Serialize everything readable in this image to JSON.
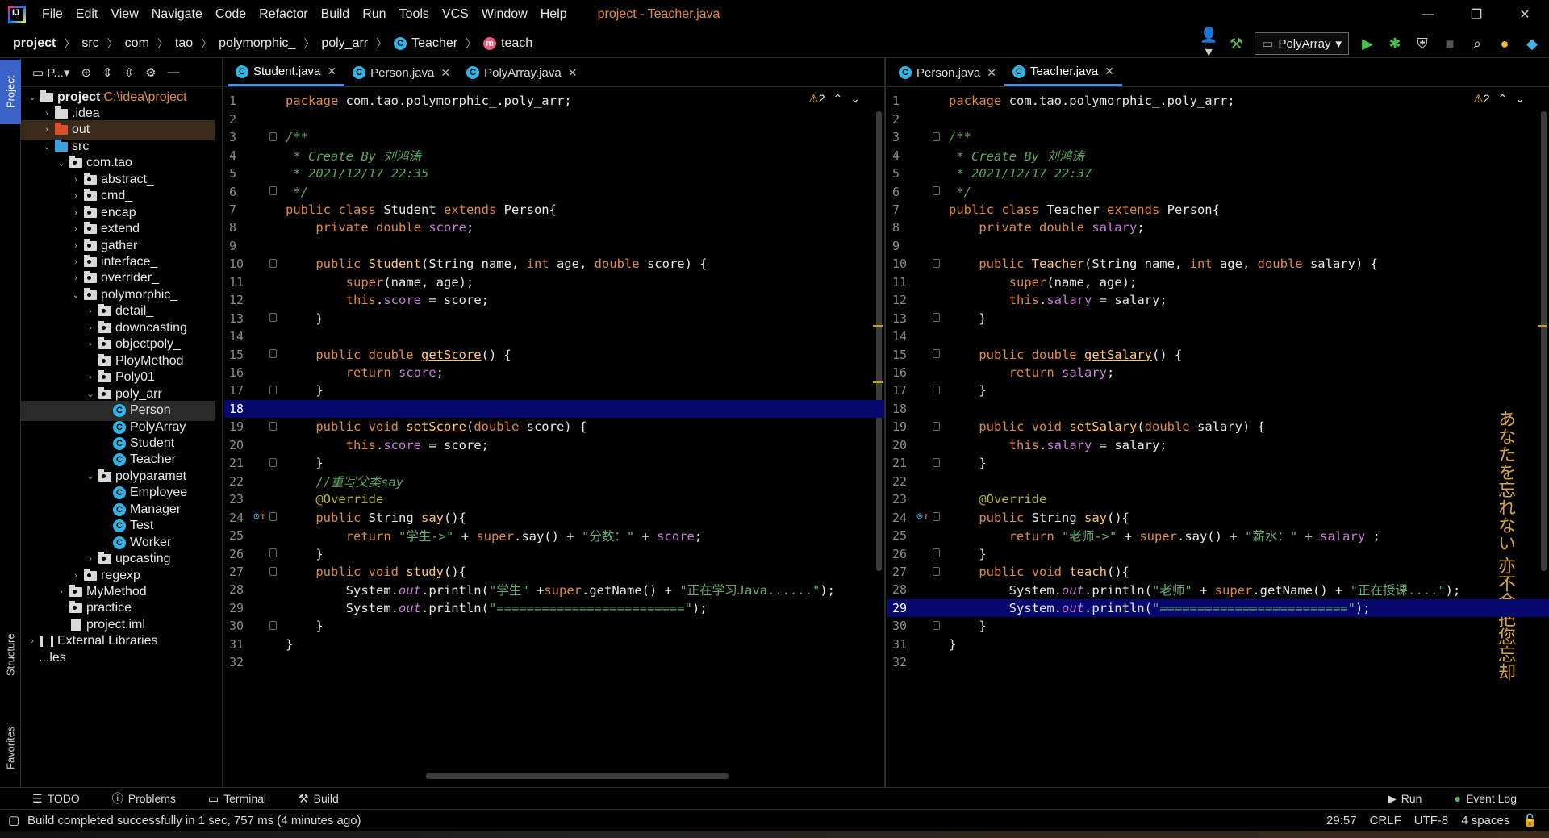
{
  "menu": {
    "items": [
      "File",
      "Edit",
      "View",
      "Navigate",
      "Code",
      "Refactor",
      "Build",
      "Run",
      "Tools",
      "VCS",
      "Window",
      "Help"
    ],
    "window_title": "project - Teacher.java"
  },
  "breadcrumb": [
    "project",
    "src",
    "com",
    "tao",
    "polymorphic_",
    "poly_arr",
    "Teacher",
    "teach"
  ],
  "run_config": "PolyArray",
  "project_panel": {
    "header": "P...",
    "tree": [
      {
        "label": "project",
        "hint": "C:\\idea\\project",
        "depth": 0,
        "type": "root",
        "arrow": "open"
      },
      {
        "label": ".idea",
        "depth": 1,
        "type": "folder",
        "arrow": "closed"
      },
      {
        "label": "out",
        "depth": 1,
        "type": "folder-red",
        "arrow": "closed"
      },
      {
        "label": "src",
        "depth": 1,
        "type": "folder-blue",
        "arrow": "open"
      },
      {
        "label": "com.tao",
        "depth": 2,
        "type": "pkg",
        "arrow": "open"
      },
      {
        "label": "abstract_",
        "depth": 3,
        "type": "pkg",
        "arrow": "closed"
      },
      {
        "label": "cmd_",
        "depth": 3,
        "type": "pkg",
        "arrow": "closed"
      },
      {
        "label": "encap",
        "depth": 3,
        "type": "pkg",
        "arrow": "closed"
      },
      {
        "label": "extend",
        "depth": 3,
        "type": "pkg",
        "arrow": "closed"
      },
      {
        "label": "gather",
        "depth": 3,
        "type": "pkg",
        "arrow": "closed"
      },
      {
        "label": "interface_",
        "depth": 3,
        "type": "pkg",
        "arrow": "closed"
      },
      {
        "label": "overrider_",
        "depth": 3,
        "type": "pkg",
        "arrow": "closed"
      },
      {
        "label": "polymorphic_",
        "depth": 3,
        "type": "pkg",
        "arrow": "open"
      },
      {
        "label": "detail_",
        "depth": 4,
        "type": "pkg",
        "arrow": "closed"
      },
      {
        "label": "downcasting",
        "depth": 4,
        "type": "pkg",
        "arrow": "closed"
      },
      {
        "label": "objectpoly_",
        "depth": 4,
        "type": "pkg",
        "arrow": "closed"
      },
      {
        "label": "PloyMethod",
        "depth": 4,
        "type": "pkg",
        "arrow": "none"
      },
      {
        "label": "Poly01",
        "depth": 4,
        "type": "pkg",
        "arrow": "closed"
      },
      {
        "label": "poly_arr",
        "depth": 4,
        "type": "pkg",
        "arrow": "open"
      },
      {
        "label": "Person",
        "depth": 5,
        "type": "class",
        "arrow": "none",
        "selected": true
      },
      {
        "label": "PolyArray",
        "depth": 5,
        "type": "class",
        "arrow": "none"
      },
      {
        "label": "Student",
        "depth": 5,
        "type": "class",
        "arrow": "none"
      },
      {
        "label": "Teacher",
        "depth": 5,
        "type": "class",
        "arrow": "none"
      },
      {
        "label": "polyparamet",
        "depth": 4,
        "type": "pkg",
        "arrow": "open"
      },
      {
        "label": "Employee",
        "depth": 5,
        "type": "class",
        "arrow": "none"
      },
      {
        "label": "Manager",
        "depth": 5,
        "type": "class",
        "arrow": "none"
      },
      {
        "label": "Test",
        "depth": 5,
        "type": "class",
        "arrow": "none"
      },
      {
        "label": "Worker",
        "depth": 5,
        "type": "class",
        "arrow": "none"
      },
      {
        "label": "upcasting",
        "depth": 4,
        "type": "pkg",
        "arrow": "closed"
      },
      {
        "label": "regexp",
        "depth": 3,
        "type": "pkg",
        "arrow": "closed"
      },
      {
        "label": "MyMethod",
        "depth": 2,
        "type": "pkg",
        "arrow": "closed"
      },
      {
        "label": "practice",
        "depth": 2,
        "type": "pkg",
        "arrow": "none"
      },
      {
        "label": "project.iml",
        "depth": 2,
        "type": "file",
        "arrow": "none"
      },
      {
        "label": "External Libraries",
        "depth": 0,
        "type": "lib",
        "arrow": "closed"
      },
      {
        "label": "...les",
        "depth": 0,
        "type": "none",
        "arrow": "none"
      }
    ]
  },
  "left_editor": {
    "tabs": [
      {
        "label": "Student.java",
        "active": true
      },
      {
        "label": "Person.java",
        "active": false
      },
      {
        "label": "PolyArray.java",
        "active": false
      }
    ],
    "warnings": "2",
    "highlight_line": 18,
    "lines": [
      [
        [
          "kw",
          "package "
        ],
        [
          "",
          "com.tao.polymorphic_.poly_arr;"
        ]
      ],
      [],
      [
        [
          "cm",
          "/**"
        ]
      ],
      [
        [
          "cm",
          " * Create By 刘鸿涛"
        ]
      ],
      [
        [
          "cm",
          " * 2021/12/17 22:35"
        ]
      ],
      [
        [
          "cm",
          " */"
        ]
      ],
      [
        [
          "kw",
          "public class "
        ],
        [
          "",
          "Student "
        ],
        [
          "kw",
          "extends "
        ],
        [
          "",
          "Person{"
        ]
      ],
      [
        [
          "",
          "    "
        ],
        [
          "kw",
          "private double "
        ],
        [
          "fld",
          "score"
        ],
        [
          "",
          ";"
        ]
      ],
      [],
      [
        [
          "",
          "    "
        ],
        [
          "kw",
          "public "
        ],
        [
          "fn",
          "Student"
        ],
        [
          "",
          "(String name, "
        ],
        [
          "kw",
          "int "
        ],
        [
          "",
          "age, "
        ],
        [
          "kw",
          "double "
        ],
        [
          "",
          "score) {"
        ]
      ],
      [
        [
          "",
          "        "
        ],
        [
          "kw",
          "super"
        ],
        [
          "",
          "(name, age);"
        ]
      ],
      [
        [
          "",
          "        "
        ],
        [
          "kw",
          "this"
        ],
        [
          "",
          "."
        ],
        [
          "fld",
          "score"
        ],
        [
          "",
          " = score;"
        ]
      ],
      [
        [
          "",
          "    }"
        ]
      ],
      [],
      [
        [
          "",
          "    "
        ],
        [
          "kw",
          "public double "
        ],
        [
          "fn ul",
          "getScore"
        ],
        [
          "",
          "() {"
        ]
      ],
      [
        [
          "",
          "        "
        ],
        [
          "kw",
          "return "
        ],
        [
          "fld",
          "score"
        ],
        [
          "",
          ";"
        ]
      ],
      [
        [
          "",
          "    }"
        ]
      ],
      [],
      [
        [
          "",
          "    "
        ],
        [
          "kw",
          "public void "
        ],
        [
          "fn ul",
          "setScore"
        ],
        [
          "",
          "("
        ],
        [
          "kw",
          "double "
        ],
        [
          "",
          "score) {"
        ]
      ],
      [
        [
          "",
          "        "
        ],
        [
          "kw",
          "this"
        ],
        [
          "",
          "."
        ],
        [
          "fld",
          "score"
        ],
        [
          "",
          " = score;"
        ]
      ],
      [
        [
          "",
          "    }"
        ]
      ],
      [
        [
          "cm",
          "    //重写父类say"
        ]
      ],
      [
        [
          "an",
          "    @Override"
        ]
      ],
      [
        [
          "",
          "    "
        ],
        [
          "kw",
          "public "
        ],
        [
          "",
          "String "
        ],
        [
          "fn",
          "say"
        ],
        [
          "",
          "(){"
        ]
      ],
      [
        [
          "",
          "        "
        ],
        [
          "kw",
          "return "
        ],
        [
          "st",
          "\"学生->\""
        ],
        [
          "",
          " + "
        ],
        [
          "kw",
          "super"
        ],
        [
          "",
          ".say() + "
        ],
        [
          "st",
          "\"分数：\""
        ],
        [
          "",
          " + "
        ],
        [
          "fld",
          "score"
        ],
        [
          "",
          ";"
        ]
      ],
      [
        [
          "",
          "    }"
        ]
      ],
      [
        [
          "",
          "    "
        ],
        [
          "kw",
          "public void "
        ],
        [
          "fn",
          "study"
        ],
        [
          "",
          "(){"
        ]
      ],
      [
        [
          "",
          "        System."
        ],
        [
          "fld it",
          "out"
        ],
        [
          "",
          ".println("
        ],
        [
          "st",
          "\"学生\""
        ],
        [
          "",
          " +"
        ],
        [
          "kw",
          "super"
        ],
        [
          "",
          ".getName() + "
        ],
        [
          "st",
          "\"正在学习Java......\""
        ],
        [
          "",
          ");"
        ]
      ],
      [
        [
          "",
          "        System."
        ],
        [
          "fld it",
          "out"
        ],
        [
          "",
          ".println("
        ],
        [
          "st",
          "\"=========================\""
        ],
        [
          "",
          ");"
        ]
      ],
      [
        [
          "",
          "    }"
        ]
      ],
      [
        [
          "",
          "}"
        ]
      ],
      []
    ]
  },
  "right_editor": {
    "tabs": [
      {
        "label": "Person.java",
        "active": false
      },
      {
        "label": "Teacher.java",
        "active": true
      }
    ],
    "warnings": "2",
    "highlight_line": 29,
    "lines": [
      [
        [
          "kw",
          "package "
        ],
        [
          "",
          "com.tao.polymorphic_.poly_arr;"
        ]
      ],
      [],
      [
        [
          "cm",
          "/**"
        ]
      ],
      [
        [
          "cm",
          " * Create By 刘鸿涛"
        ]
      ],
      [
        [
          "cm",
          " * 2021/12/17 22:37"
        ]
      ],
      [
        [
          "cm",
          " */"
        ]
      ],
      [
        [
          "kw",
          "public class "
        ],
        [
          "",
          "Teacher "
        ],
        [
          "kw",
          "extends "
        ],
        [
          "",
          "Person{"
        ]
      ],
      [
        [
          "",
          "    "
        ],
        [
          "kw",
          "private double "
        ],
        [
          "fld",
          "salary"
        ],
        [
          "",
          ";"
        ]
      ],
      [],
      [
        [
          "",
          "    "
        ],
        [
          "kw",
          "public "
        ],
        [
          "fn",
          "Teacher"
        ],
        [
          "",
          "(String name, "
        ],
        [
          "kw",
          "int "
        ],
        [
          "",
          "age, "
        ],
        [
          "kw",
          "double "
        ],
        [
          "",
          "salary) {"
        ]
      ],
      [
        [
          "",
          "        "
        ],
        [
          "kw",
          "super"
        ],
        [
          "",
          "(name, age);"
        ]
      ],
      [
        [
          "",
          "        "
        ],
        [
          "kw",
          "this"
        ],
        [
          "",
          "."
        ],
        [
          "fld",
          "salary"
        ],
        [
          "",
          " = salary;"
        ]
      ],
      [
        [
          "",
          "    }"
        ]
      ],
      [],
      [
        [
          "",
          "    "
        ],
        [
          "kw",
          "public double "
        ],
        [
          "fn ul",
          "getSalary"
        ],
        [
          "",
          "() {"
        ]
      ],
      [
        [
          "",
          "        "
        ],
        [
          "kw",
          "return "
        ],
        [
          "fld",
          "salary"
        ],
        [
          "",
          ";"
        ]
      ],
      [
        [
          "",
          "    }"
        ]
      ],
      [],
      [
        [
          "",
          "    "
        ],
        [
          "kw",
          "public void "
        ],
        [
          "fn ul",
          "setSalary"
        ],
        [
          "",
          "("
        ],
        [
          "kw",
          "double "
        ],
        [
          "",
          "salary) {"
        ]
      ],
      [
        [
          "",
          "        "
        ],
        [
          "kw",
          "this"
        ],
        [
          "",
          "."
        ],
        [
          "fld",
          "salary"
        ],
        [
          "",
          " = salary;"
        ]
      ],
      [
        [
          "",
          "    }"
        ]
      ],
      [],
      [
        [
          "an",
          "    @Override"
        ]
      ],
      [
        [
          "",
          "    "
        ],
        [
          "kw",
          "public "
        ],
        [
          "",
          "String "
        ],
        [
          "fn",
          "say"
        ],
        [
          "",
          "(){"
        ]
      ],
      [
        [
          "",
          "        "
        ],
        [
          "kw",
          "return "
        ],
        [
          "st",
          "\"老师->\""
        ],
        [
          "",
          " + "
        ],
        [
          "kw",
          "super"
        ],
        [
          "",
          ".say() + "
        ],
        [
          "st",
          "\"薪水：\""
        ],
        [
          "",
          " + "
        ],
        [
          "fld",
          "salary"
        ],
        [
          "",
          " ;"
        ]
      ],
      [
        [
          "",
          "    }"
        ]
      ],
      [
        [
          "",
          "    "
        ],
        [
          "kw",
          "public void "
        ],
        [
          "fn",
          "teach"
        ],
        [
          "",
          "(){"
        ]
      ],
      [
        [
          "",
          "        System."
        ],
        [
          "fld it",
          "out"
        ],
        [
          "",
          ".println("
        ],
        [
          "st",
          "\"老师\""
        ],
        [
          "",
          " + "
        ],
        [
          "kw",
          "super"
        ],
        [
          "",
          ".getName() + "
        ],
        [
          "st",
          "\"正在授课....\""
        ],
        [
          "",
          ");"
        ]
      ],
      [
        [
          "",
          "        System."
        ],
        [
          "fld it",
          "out"
        ],
        [
          "",
          ".println("
        ],
        [
          "st",
          "\"=========================\""
        ],
        [
          "",
          ");"
        ]
      ],
      [
        [
          "",
          "    }"
        ]
      ],
      [
        [
          "",
          "}"
        ]
      ],
      []
    ]
  },
  "decor_text": [
    "亦不会把您忘却",
    "あなたを忘れない"
  ],
  "toolwindows": {
    "left": [
      "TODO",
      "Problems",
      "Terminal",
      "Build"
    ],
    "right": [
      "Run",
      "Event Log"
    ]
  },
  "side_tabs": {
    "project": "Project",
    "structure": "Structure",
    "favorites": "Favorites"
  },
  "status": {
    "message": "Build completed successfully in 1 sec, 757 ms (4 minutes ago)",
    "position": "29:57",
    "line_sep": "CRLF",
    "encoding": "UTF-8",
    "indent": "4 spaces"
  }
}
